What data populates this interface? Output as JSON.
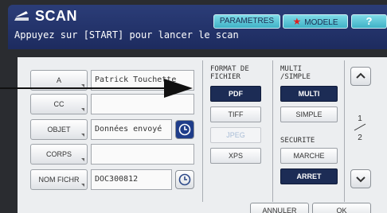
{
  "header": {
    "title": "SCAN",
    "buttons": {
      "parametres": "PARAMETRES",
      "modele": "MODELE",
      "help": "?"
    },
    "message": "Appuyez sur [START] pour lancer le scan"
  },
  "fields": [
    {
      "label": "A",
      "value": "Patrick Touchette"
    },
    {
      "label": "CC",
      "value": ""
    },
    {
      "label": "OBJET",
      "value": "Données envoyé"
    },
    {
      "label": "CORPS",
      "value": ""
    },
    {
      "label": "NOM FICHR",
      "value": "DOC300812"
    }
  ],
  "format": {
    "heading": "FORMAT DE\nFICHIER",
    "options": [
      "PDF",
      "TIFF",
      "JPEG",
      "XPS"
    ],
    "selected": "PDF",
    "disabled": "JPEG"
  },
  "multi": {
    "heading": "MULTI\n/SIMPLE",
    "options": [
      "MULTI",
      "SIMPLE"
    ],
    "selected": "MULTI"
  },
  "security": {
    "heading": "SECURITE",
    "options": [
      "MARCHE",
      "ARRET"
    ],
    "selected": "ARRET"
  },
  "pagination": {
    "current": "1",
    "total": "2"
  },
  "footer": {
    "cancel": "ANNULER",
    "ok": "OK"
  },
  "colors": {
    "header_bg": "#1d2b5f",
    "accent_cyan": "#3fb2c6",
    "selected_button": "#1c2c55",
    "panel_bg": "#eceef0",
    "clock_blue": "#1f3d8a"
  },
  "icons": [
    "scan-icon",
    "star-icon",
    "clock-icon",
    "chevron-up-icon",
    "chevron-down-icon",
    "arrow-annotation"
  ]
}
